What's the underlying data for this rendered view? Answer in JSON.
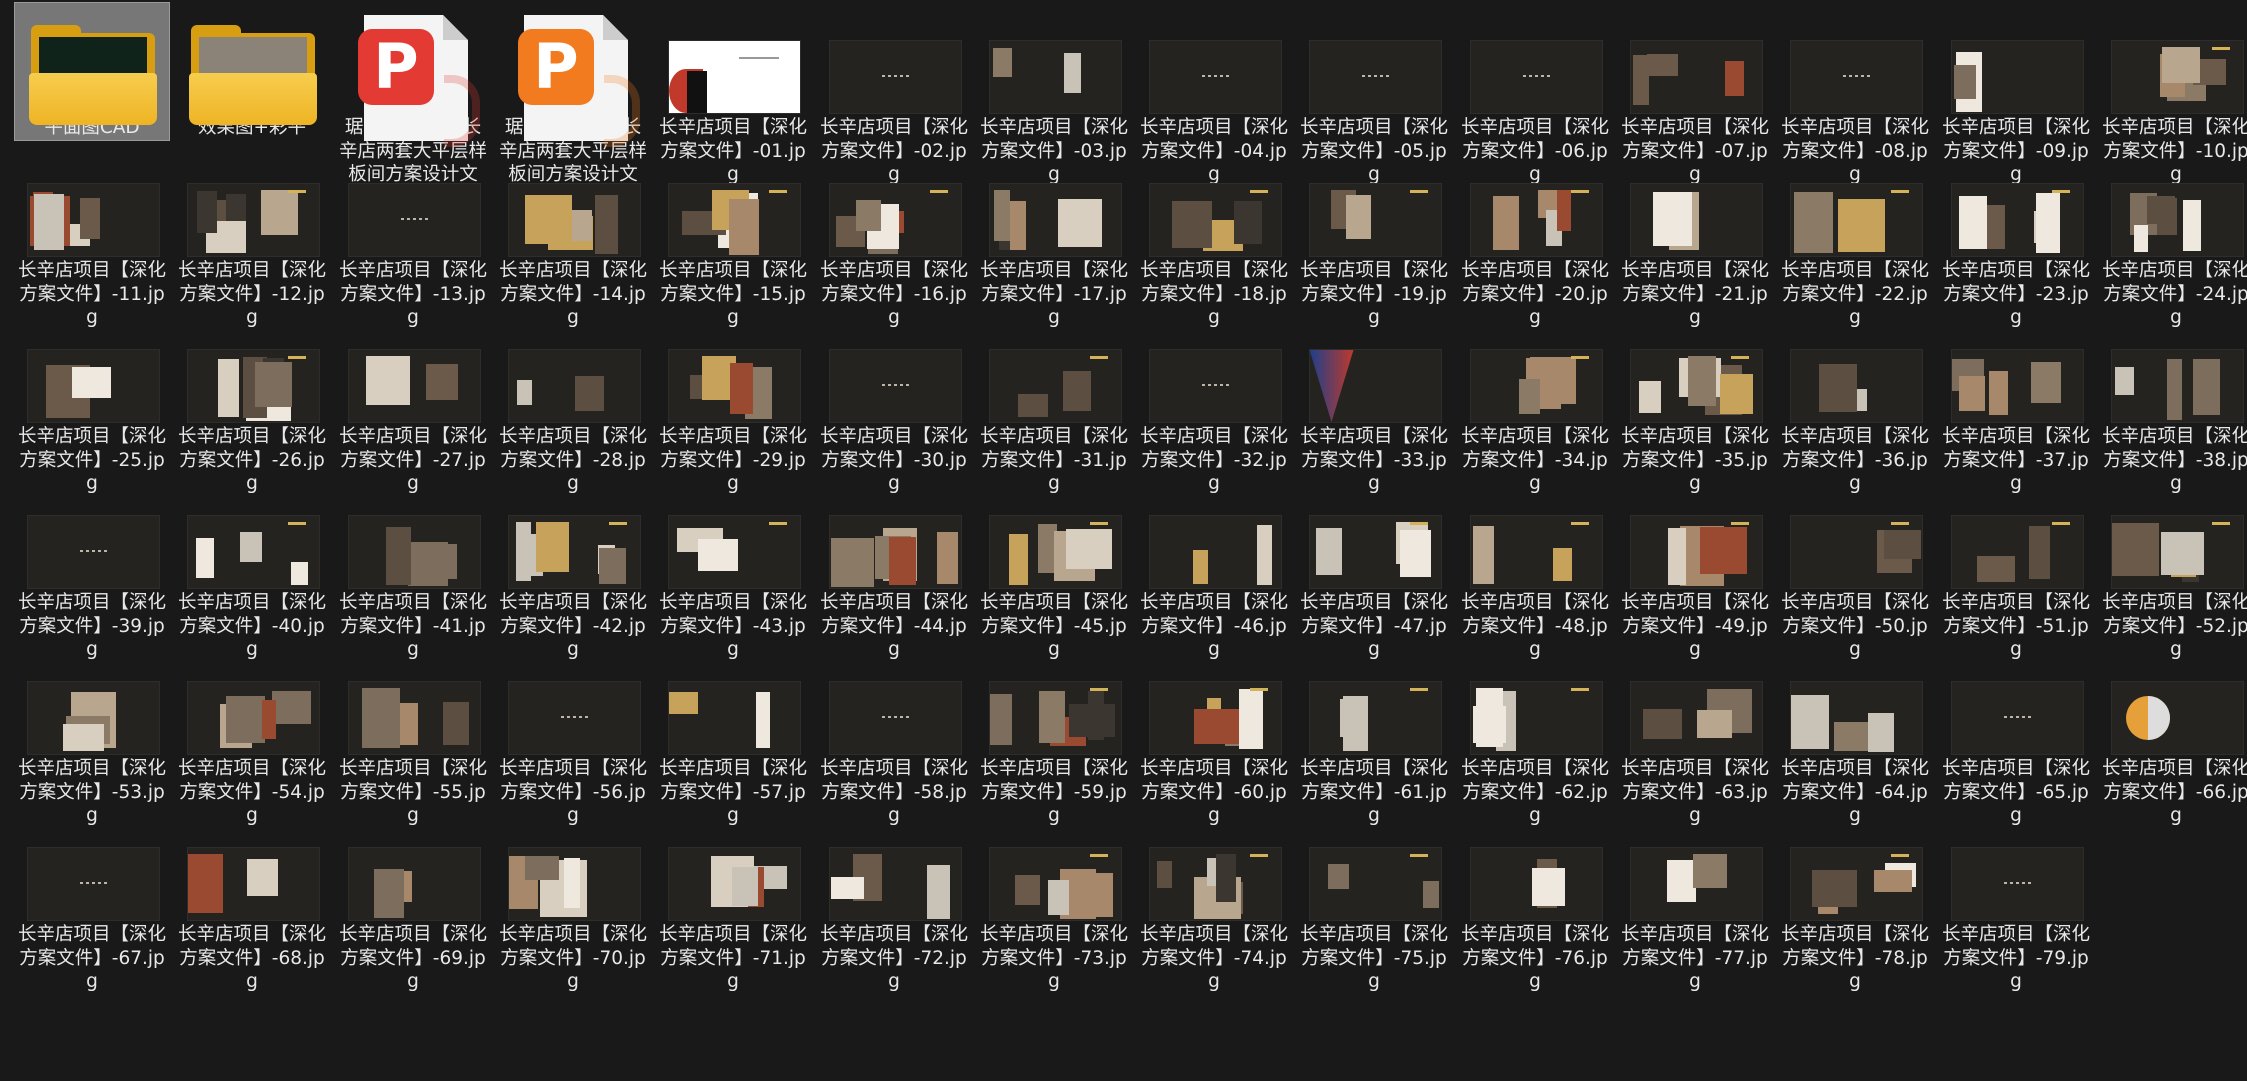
{
  "folders": [
    {
      "label": "平面图CAD",
      "icon": "folder-icon",
      "selected": true
    },
    {
      "label": "效果图+彩平",
      "icon": "folder-icon",
      "selected": false
    }
  ],
  "documents": [
    {
      "label": "琚宾-北京金隅长辛店两套大平层样板间方案设计文本.pdf",
      "icon": "pdf-icon",
      "glyph": "P",
      "color": "#e33b34"
    },
    {
      "label": "琚宾-北京金隅长辛店两套大平层样板间方案设计文本.pptx",
      "icon": "pptx-icon",
      "glyph": "P",
      "color": "#f27a1f"
    }
  ],
  "images": {
    "name_prefix": "长辛店项目【深化方案文件】-",
    "extension": ".jpg",
    "numbers": [
      "01",
      "02",
      "03",
      "04",
      "05",
      "06",
      "07",
      "08",
      "09",
      "10",
      "11",
      "12",
      "13",
      "14",
      "15",
      "16",
      "17",
      "18",
      "19",
      "20",
      "21",
      "22",
      "23",
      "24",
      "25",
      "26",
      "27",
      "28",
      "29",
      "30",
      "31",
      "32",
      "33",
      "34",
      "35",
      "36",
      "37",
      "38",
      "39",
      "40",
      "41",
      "42",
      "43",
      "44",
      "45",
      "46",
      "47",
      "48",
      "49",
      "50",
      "51",
      "52",
      "53",
      "54",
      "55",
      "56",
      "57",
      "58",
      "59",
      "60",
      "61",
      "62",
      "63",
      "64",
      "65",
      "66",
      "67",
      "68",
      "69",
      "70",
      "71",
      "72",
      "73",
      "74",
      "75",
      "76",
      "77",
      "78",
      "79"
    ]
  },
  "colors": {
    "background": "#191919",
    "text": "#e8e8e8",
    "selection": "#777777"
  }
}
